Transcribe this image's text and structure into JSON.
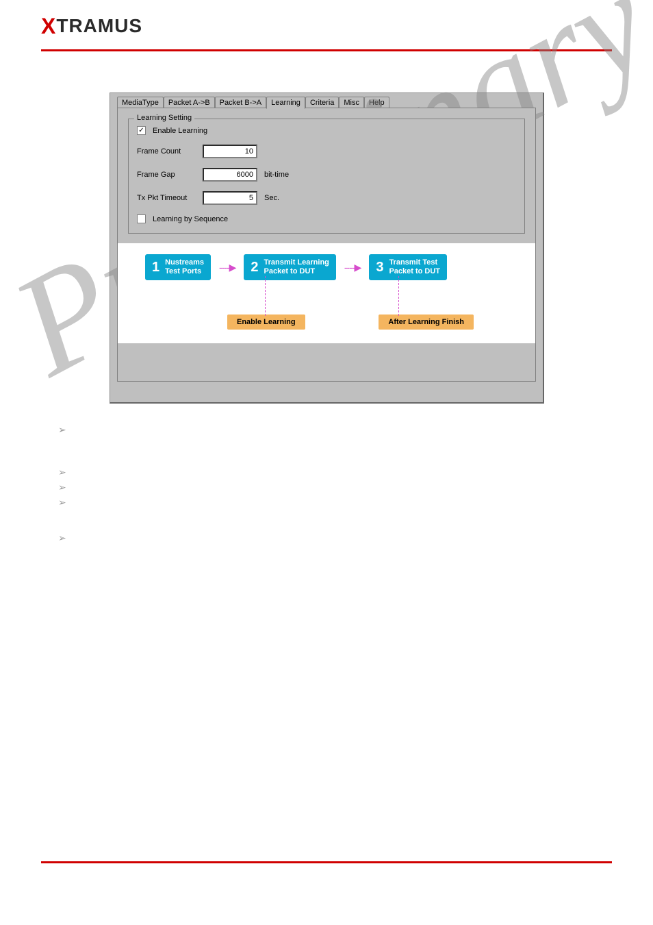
{
  "logo": {
    "x": "X",
    "rest": "TRAMUS"
  },
  "tabs": [
    "MediaType",
    "Packet A->B",
    "Packet B->A",
    "Learning",
    "Criteria",
    "Misc",
    "Help"
  ],
  "active_tab_index": 3,
  "group": {
    "title": "Learning Setting",
    "enable_learning": {
      "label": "Enable Learning",
      "checked": true
    },
    "frame_count": {
      "label": "Frame Count",
      "value": "10"
    },
    "frame_gap": {
      "label": "Frame Gap",
      "value": "6000",
      "unit": "bit-time"
    },
    "tx_timeout": {
      "label": "Tx Pkt Timeout",
      "value": "5",
      "unit": "Sec."
    },
    "learn_seq": {
      "label": "Learning by Sequence",
      "checked": false
    }
  },
  "diagram": {
    "steps": [
      {
        "num": "1",
        "line1": "Nustreams",
        "line2": "Test Ports"
      },
      {
        "num": "2",
        "line1": "Transmit Learning",
        "line2": "Packet to DUT"
      },
      {
        "num": "3",
        "line1": "Transmit Test",
        "line2": "Packet to DUT"
      }
    ],
    "notes": [
      "Enable Learning",
      "After Learning Finish"
    ]
  },
  "watermark": "Preliminary"
}
